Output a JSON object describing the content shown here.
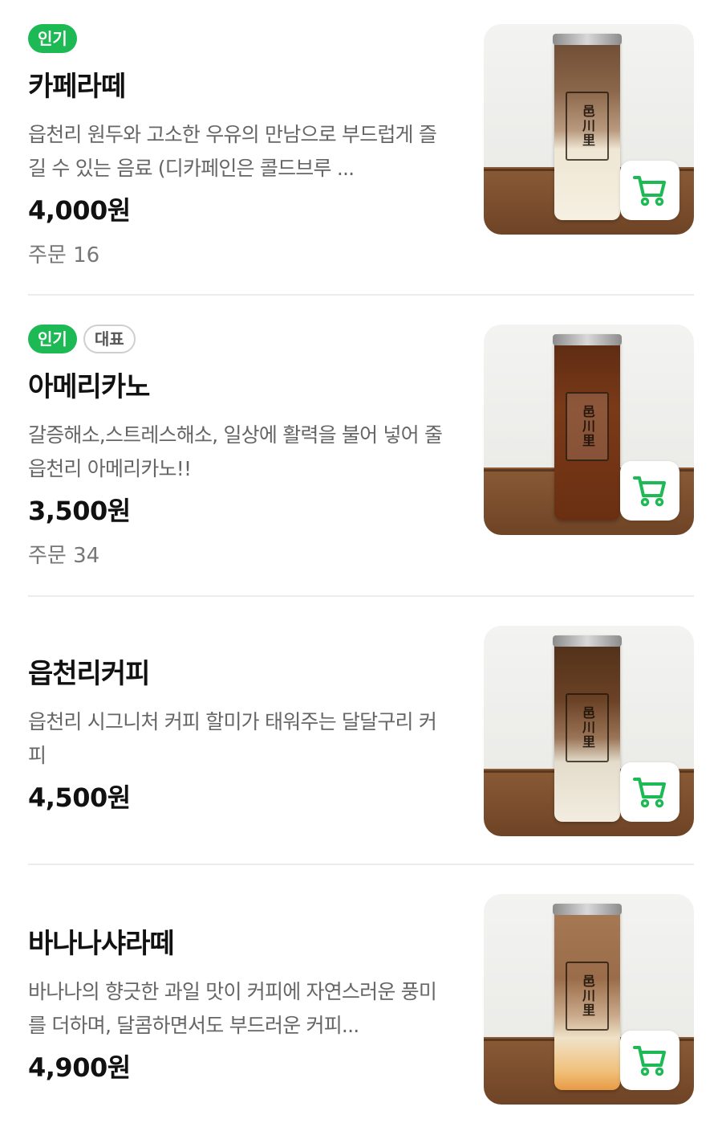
{
  "menu": {
    "cart_icon": "cart-icon",
    "accent_color": "#1db954",
    "items": [
      {
        "badges": [
          "인기"
        ],
        "name": "카페라떼",
        "description": "읍천리 원두와 고소한 우유의 만남으로 부드럽게 즐길 수 있는 음료 (디카페인은 콜드브루 ...",
        "price": "4,000원",
        "orders": "주문 16",
        "label_text": "邑川里"
      },
      {
        "badges": [
          "인기",
          "대표"
        ],
        "name": "아메리카노",
        "description": "갈증해소,스트레스해소, 일상에 활력을 불어 넣어 줄 읍천리 아메리카노!!",
        "price": "3,500원",
        "orders": "주문 34",
        "label_text": "邑川里"
      },
      {
        "badges": [],
        "name": "읍천리커피",
        "description": "읍천리 시그니처 커피 할미가 태워주는 달달구리 커피",
        "price": "4,500원",
        "orders": "",
        "label_text": "邑川里"
      },
      {
        "badges": [],
        "name": "바나나샤라떼",
        "description": "바나나의 향긋한 과일 맛이 커피에 자연스러운 풍미를 더하며, 달콤하면서도 부드러운 커피...",
        "price": "4,900원",
        "orders": "",
        "label_text": "邑川里"
      }
    ]
  }
}
